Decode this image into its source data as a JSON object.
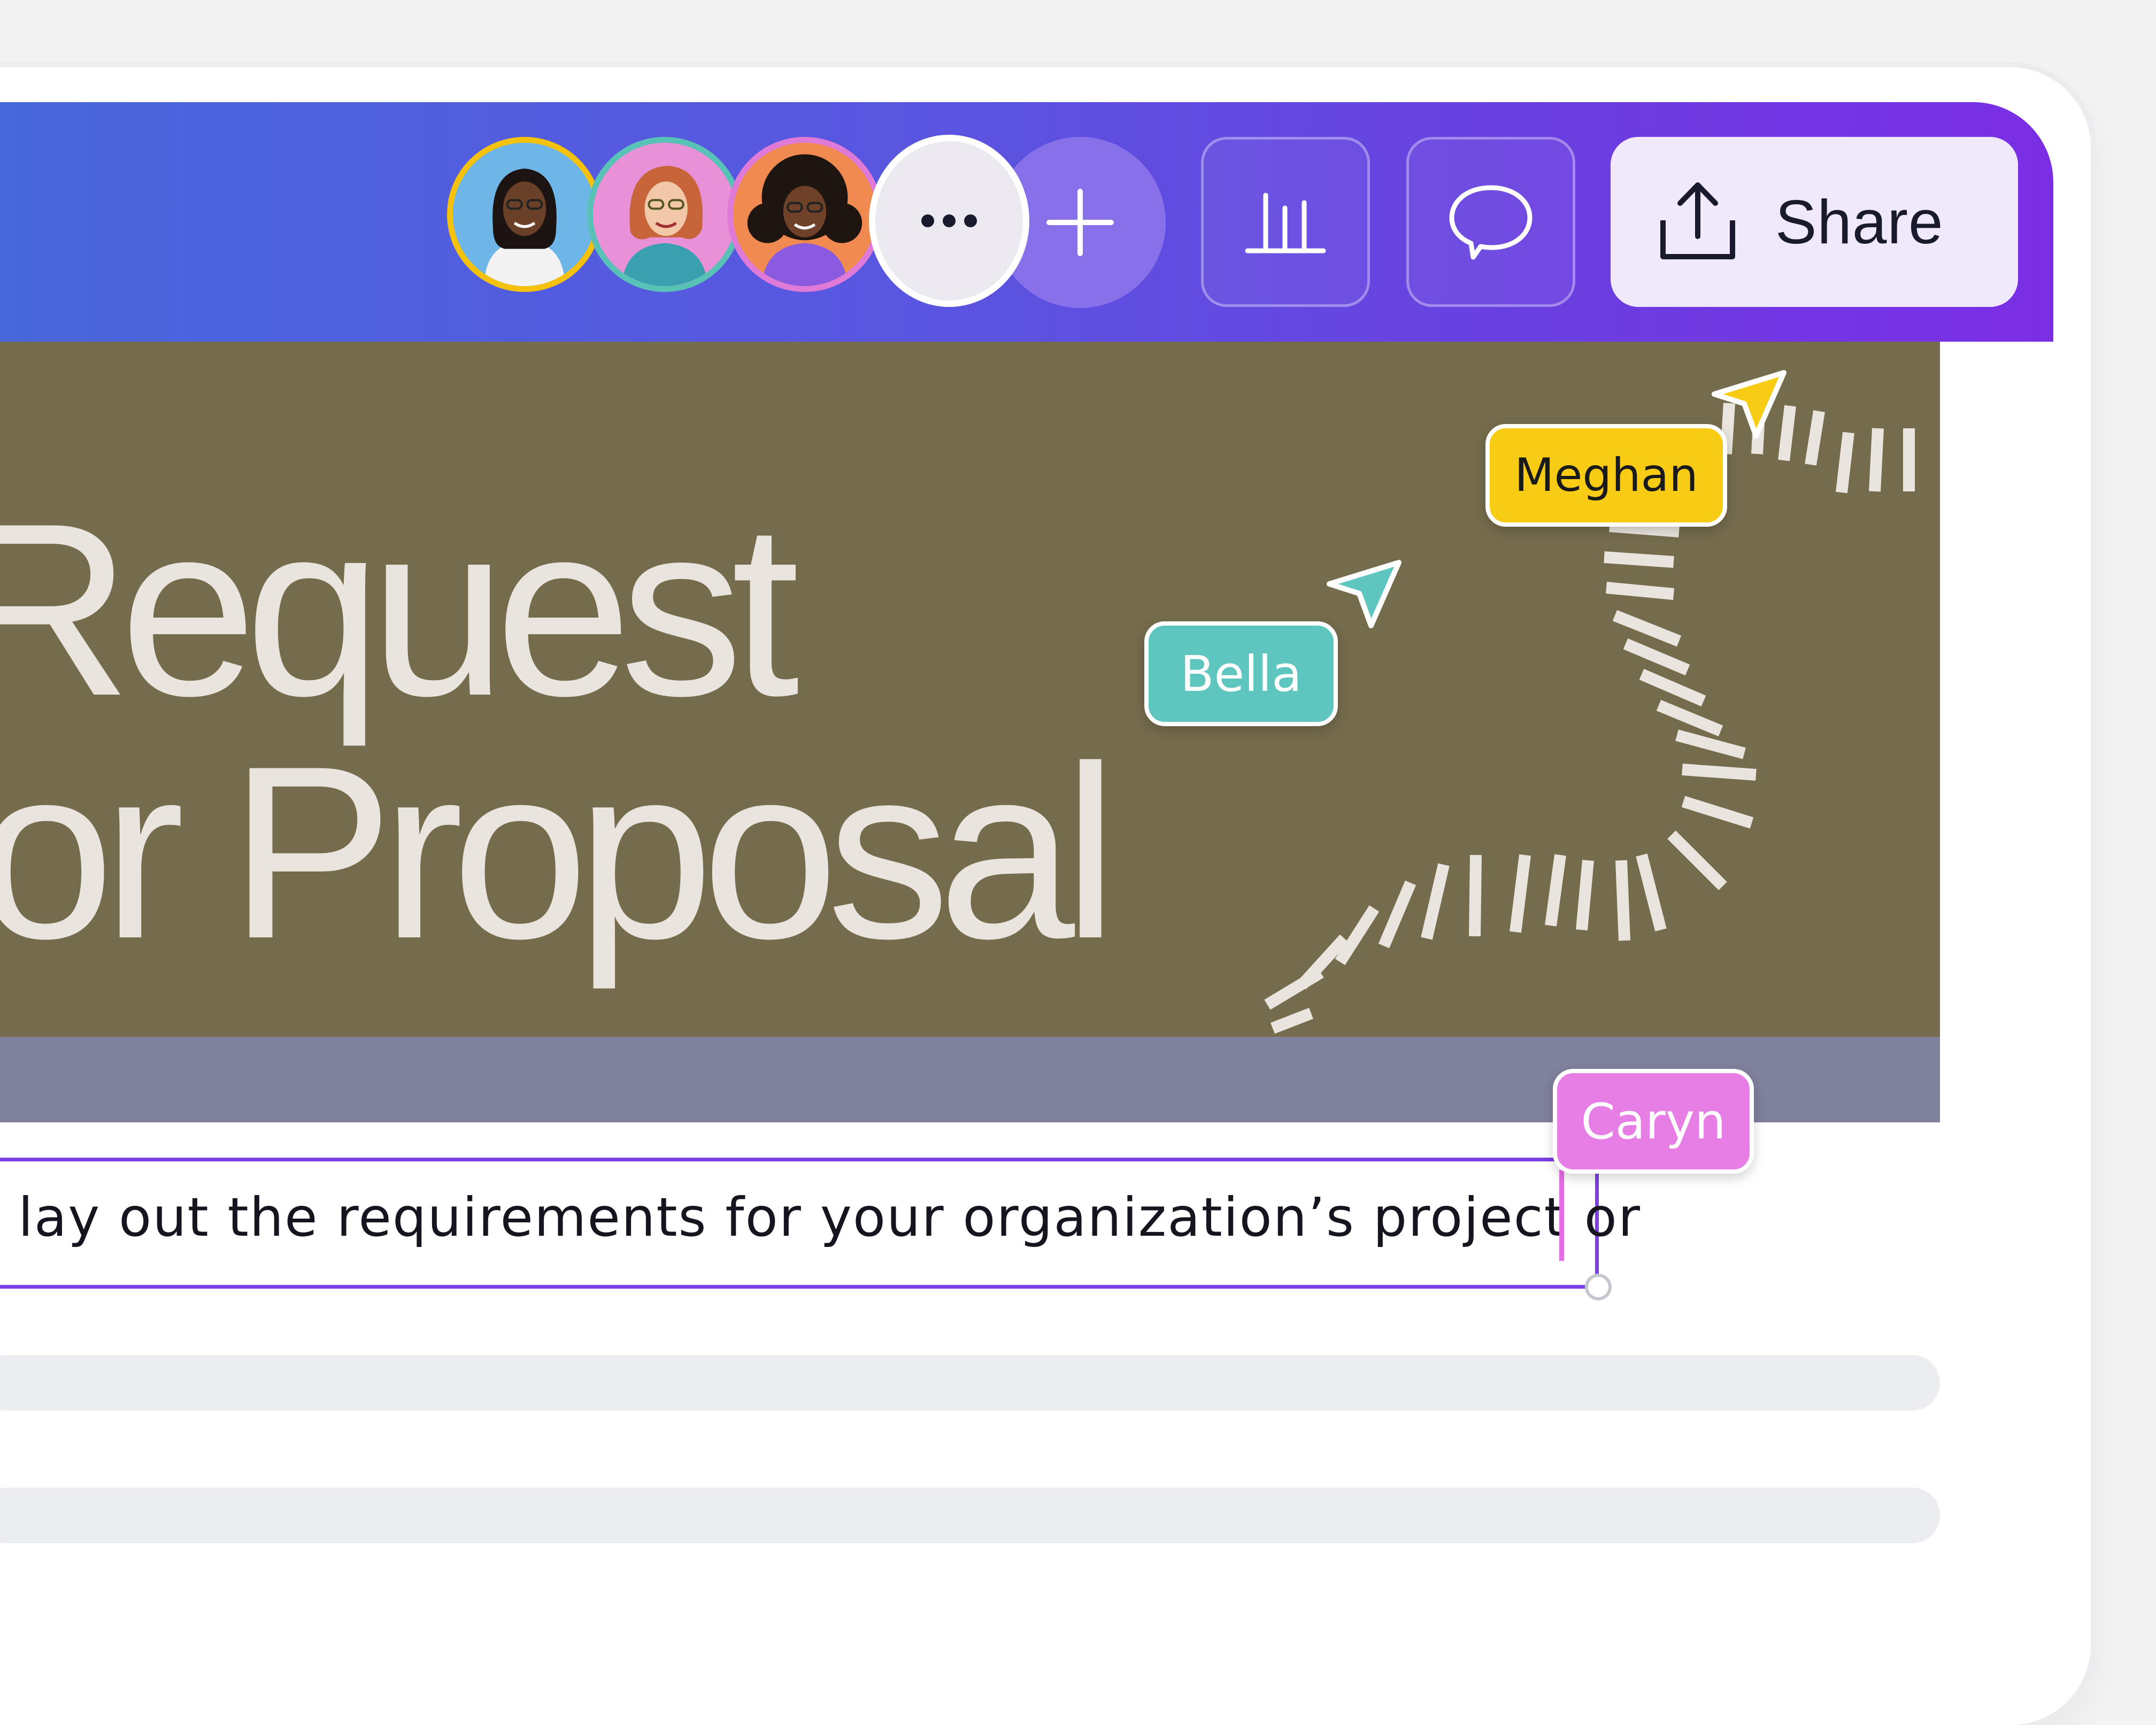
{
  "toolbar": {
    "collaborators": [
      {
        "name": "avatar-1",
        "ring": "#f4c20d",
        "bg": "#6fb6e8"
      },
      {
        "name": "avatar-2",
        "ring": "#58c2b6",
        "bg": "#e890d8"
      },
      {
        "name": "avatar-3",
        "ring": "#e07ad8",
        "bg": "#f0a070"
      }
    ],
    "more_icon": "more-horizontal-icon",
    "add_icon": "plus-icon",
    "insights_icon": "bar-chart-icon",
    "comments_icon": "comment-bubble-icon",
    "share_icon": "upload-icon",
    "share_label": "Share"
  },
  "canvas": {
    "title_line_1": "Request",
    "title_line_2": "or Proposal",
    "hero_color": "#756b4d",
    "strip_color": "#7f819d"
  },
  "cursors": [
    {
      "label": "Meghan",
      "color": "#f8cc14",
      "text_color": "#1a1a1a"
    },
    {
      "label": "Bella",
      "color": "#5ec6be",
      "text_color": "#ffffff"
    },
    {
      "label": "Caryn",
      "color": "#e67ee6",
      "text_color": "#ffffff"
    }
  ],
  "text_box": {
    "content": "lay out the requirements for your organization’s project or"
  },
  "colors": {
    "accent": "#7b3fe4",
    "toolbar_start": "#4867dc",
    "toolbar_end": "#7b2ee4"
  }
}
